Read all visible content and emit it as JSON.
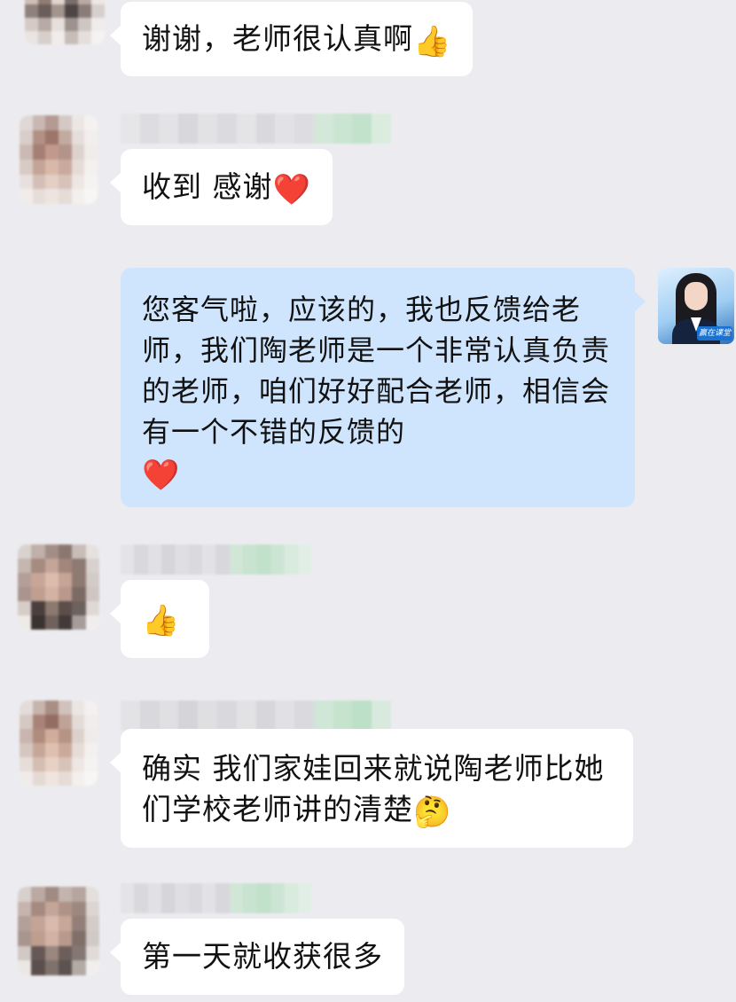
{
  "messages": [
    {
      "sender": "other",
      "text": "谢谢，老师很认真啊",
      "emoji": "👍"
    },
    {
      "sender": "other",
      "text": "收到 感谢",
      "emoji": "❤️"
    },
    {
      "sender": "self",
      "text": "您客气啦，应该的，我也反馈给老师，我们陶老师是一个非常认真负责的老师，咱们好好配合老师，相信会有一个不错的反馈的",
      "emoji": "❤️"
    },
    {
      "sender": "other",
      "text": "",
      "emoji": "👍"
    },
    {
      "sender": "other",
      "text": "确实 我们家娃回来就说陶老师比她们学校老师讲的清楚",
      "emoji": "🤔"
    },
    {
      "sender": "other",
      "text": "第一天就收获很多",
      "emoji": ""
    }
  ],
  "self_avatar": {
    "badge_text": "赢在课堂"
  },
  "colors": {
    "background": "#ececf0",
    "incoming_bubble": "#ffffff",
    "outgoing_bubble": "#cfe5fd"
  }
}
